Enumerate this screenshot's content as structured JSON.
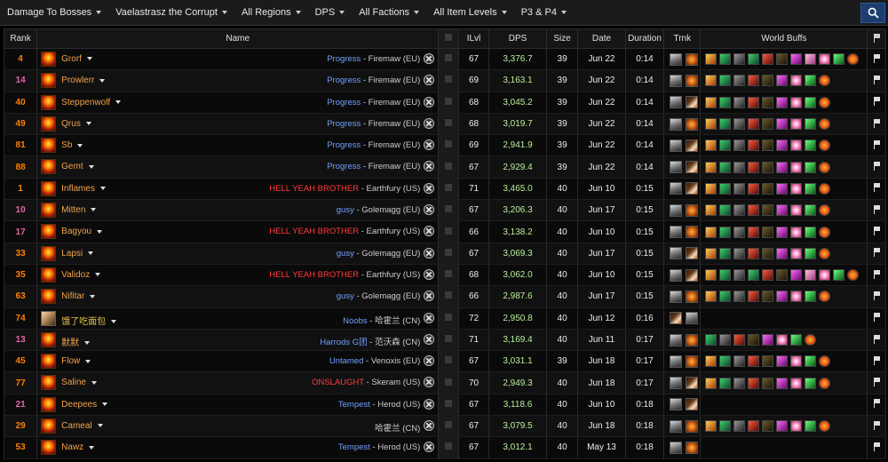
{
  "filters": [
    {
      "label": "Damage To Bosses"
    },
    {
      "label": "Vaelastrasz the Corrupt"
    },
    {
      "label": "All Regions"
    },
    {
      "label": "DPS"
    },
    {
      "label": "All Factions"
    },
    {
      "label": "All Item Levels"
    },
    {
      "label": "P3 & P4"
    }
  ],
  "columns": {
    "rank": "Rank",
    "name": "Name",
    "ilvl": "ILvl",
    "dps": "DPS",
    "size": "Size",
    "date": "Date",
    "duration": "Duration",
    "trnk": "Trnk",
    "buffs": "World Buffs"
  },
  "rows": [
    {
      "rank": "4",
      "rank_color": "orange",
      "name": "Grorf",
      "class": "mage",
      "guild": "Progress",
      "guild_color": "blue",
      "server": " - Firemaw (EU)",
      "ilvl": "67",
      "dps": "3,376.7",
      "size": "39",
      "date": "Jun 22",
      "duration": "0:14",
      "trnk": [
        "sapper",
        "bag"
      ],
      "buffs": [
        "b-ony",
        "b-zg",
        "b-dmf",
        "b-zg",
        "b-dm1",
        "b-dm2",
        "b-sp",
        "b-pink",
        "b-star",
        "b-green",
        "b-orange"
      ]
    },
    {
      "rank": "14",
      "rank_color": "pink",
      "name": "Prowlerr",
      "class": "mage",
      "guild": "Progress",
      "guild_color": "blue",
      "server": " - Firemaw (EU)",
      "ilvl": "69",
      "dps": "3,163.1",
      "size": "39",
      "date": "Jun 22",
      "duration": "0:14",
      "trnk": [
        "sapper",
        "bag"
      ],
      "buffs": [
        "b-ony",
        "b-zg",
        "b-dmf",
        "b-dm1",
        "b-dm2",
        "b-sp",
        "b-star",
        "b-green",
        "b-orange"
      ]
    },
    {
      "rank": "40",
      "rank_color": "orange",
      "name": "Steppenwolf",
      "class": "mage",
      "guild": "Progress",
      "guild_color": "blue",
      "server": " - Firemaw (EU)",
      "ilvl": "68",
      "dps": "3,045.2",
      "size": "39",
      "date": "Jun 22",
      "duration": "0:14",
      "trnk": [
        "sapper",
        "feather"
      ],
      "buffs": [
        "b-ony",
        "b-zg",
        "b-dmf",
        "b-dm1",
        "b-dm2",
        "b-sp",
        "b-star",
        "b-green",
        "b-orange"
      ]
    },
    {
      "rank": "49",
      "rank_color": "orange",
      "name": "Qrus",
      "class": "mage",
      "guild": "Progress",
      "guild_color": "blue",
      "server": " - Firemaw (EU)",
      "ilvl": "68",
      "dps": "3,019.7",
      "size": "39",
      "date": "Jun 22",
      "duration": "0:14",
      "trnk": [
        "sapper",
        "bag"
      ],
      "buffs": [
        "b-ony",
        "b-zg",
        "b-dmf",
        "b-dm1",
        "b-dm2",
        "b-sp",
        "b-star",
        "b-green",
        "b-orange"
      ]
    },
    {
      "rank": "81",
      "rank_color": "orange",
      "name": "Sb",
      "class": "mage",
      "guild": "Progress",
      "guild_color": "blue",
      "server": " - Firemaw (EU)",
      "ilvl": "69",
      "dps": "2,941.9",
      "size": "39",
      "date": "Jun 22",
      "duration": "0:14",
      "trnk": [
        "sapper",
        "feather"
      ],
      "buffs": [
        "b-ony",
        "b-zg",
        "b-dmf",
        "b-dm1",
        "b-dm2",
        "b-sp",
        "b-star",
        "b-green",
        "b-orange"
      ]
    },
    {
      "rank": "88",
      "rank_color": "orange",
      "name": "Gemt",
      "class": "mage",
      "guild": "Progress",
      "guild_color": "blue",
      "server": " - Firemaw (EU)",
      "ilvl": "67",
      "dps": "2,929.4",
      "size": "39",
      "date": "Jun 22",
      "duration": "0:14",
      "trnk": [
        "sapper",
        "feather"
      ],
      "buffs": [
        "b-ony",
        "b-zg",
        "b-dmf",
        "b-dm1",
        "b-dm2",
        "b-sp",
        "b-star",
        "b-green",
        "b-orange"
      ]
    },
    {
      "rank": "1",
      "rank_color": "orange",
      "name": "Inflames",
      "class": "mage",
      "guild": "HELL YEAH BROTHER",
      "guild_color": "red",
      "server": " - Earthfury (US)",
      "ilvl": "71",
      "dps": "3,465.0",
      "size": "40",
      "date": "Jun 10",
      "duration": "0:15",
      "trnk": [
        "sapper",
        "feather"
      ],
      "buffs": [
        "b-ony",
        "b-zg",
        "b-dmf",
        "b-dm1",
        "b-dm2",
        "b-sp",
        "b-star",
        "b-green",
        "b-orange"
      ]
    },
    {
      "rank": "10",
      "rank_color": "pink",
      "name": "Mitten",
      "class": "mage",
      "guild": "gusy",
      "guild_color": "blue",
      "server": " - Golemagg (EU)",
      "ilvl": "67",
      "dps": "3,206.3",
      "size": "40",
      "date": "Jun 17",
      "duration": "0:15",
      "trnk": [
        "sapper",
        "bag"
      ],
      "buffs": [
        "b-ony",
        "b-zg",
        "b-dmf",
        "b-dm1",
        "b-dm2",
        "b-sp",
        "b-star",
        "b-green",
        "b-orange"
      ]
    },
    {
      "rank": "17",
      "rank_color": "pink",
      "name": "Bagyou",
      "class": "mage",
      "guild": "HELL YEAH BROTHER",
      "guild_color": "red",
      "server": " - Earthfury (US)",
      "ilvl": "66",
      "dps": "3,138.2",
      "size": "40",
      "date": "Jun 10",
      "duration": "0:15",
      "trnk": [
        "sapper",
        "bag"
      ],
      "buffs": [
        "b-ony",
        "b-zg",
        "b-dmf",
        "b-dm1",
        "b-dm2",
        "b-sp",
        "b-star",
        "b-green",
        "b-orange"
      ]
    },
    {
      "rank": "33",
      "rank_color": "orange",
      "name": "Lapsi",
      "class": "mage",
      "guild": "gusy",
      "guild_color": "blue",
      "server": " - Golemagg (EU)",
      "ilvl": "67",
      "dps": "3,069.3",
      "size": "40",
      "date": "Jun 17",
      "duration": "0:15",
      "trnk": [
        "sapper",
        "feather"
      ],
      "buffs": [
        "b-ony",
        "b-zg",
        "b-dmf",
        "b-dm1",
        "b-dm2",
        "b-sp",
        "b-star",
        "b-green",
        "b-orange"
      ]
    },
    {
      "rank": "35",
      "rank_color": "orange",
      "name": "Validoz",
      "class": "mage",
      "guild": "HELL YEAH BROTHER",
      "guild_color": "red",
      "server": " - Earthfury (US)",
      "ilvl": "68",
      "dps": "3,062.0",
      "size": "40",
      "date": "Jun 10",
      "duration": "0:15",
      "trnk": [
        "sapper",
        "feather"
      ],
      "buffs": [
        "b-ony",
        "b-zg",
        "b-dmf",
        "b-zg",
        "b-dm1",
        "b-dm2",
        "b-sp",
        "b-pink",
        "b-star",
        "b-green",
        "b-orange"
      ]
    },
    {
      "rank": "63",
      "rank_color": "orange",
      "name": "Nifitar",
      "class": "mage",
      "guild": "gusy",
      "guild_color": "blue",
      "server": " - Golemagg (EU)",
      "ilvl": "66",
      "dps": "2,987.6",
      "size": "40",
      "date": "Jun 17",
      "duration": "0:15",
      "trnk": [
        "sapper",
        "bag"
      ],
      "buffs": [
        "b-ony",
        "b-zg",
        "b-dmf",
        "b-dm1",
        "b-dm2",
        "b-sp",
        "b-star",
        "b-green",
        "b-orange"
      ]
    },
    {
      "rank": "74",
      "rank_color": "orange",
      "name": "饿了吃面包",
      "class": "pala",
      "guild": "Noobs",
      "guild_color": "blue",
      "server": " - 哈霍兰 (CN)",
      "ilvl": "72",
      "dps": "2,950.8",
      "size": "40",
      "date": "Jun 12",
      "duration": "0:16",
      "trnk": [
        "feather",
        "sapper"
      ],
      "buffs": []
    },
    {
      "rank": "13",
      "rank_color": "pink",
      "name": "默默",
      "class": "mage",
      "guild": "Harrods G团",
      "guild_color": "blue",
      "server": " - 范沃森 (CN)",
      "ilvl": "71",
      "dps": "3,169.4",
      "size": "40",
      "date": "Jun 11",
      "duration": "0:17",
      "trnk": [
        "sapper",
        "bag"
      ],
      "buffs": [
        "b-zg",
        "b-dmf",
        "b-dm1",
        "b-dm2",
        "b-sp",
        "b-star",
        "b-green",
        "b-orange"
      ]
    },
    {
      "rank": "45",
      "rank_color": "orange",
      "name": "Flow",
      "class": "mage",
      "guild": "Untamed",
      "guild_color": "blue",
      "server": " - Venoxis (EU)",
      "ilvl": "67",
      "dps": "3,031.1",
      "size": "39",
      "date": "Jun 18",
      "duration": "0:17",
      "trnk": [
        "sapper",
        "bag"
      ],
      "buffs": [
        "b-ony",
        "b-zg",
        "b-dmf",
        "b-dm1",
        "b-dm2",
        "b-sp",
        "b-star",
        "b-green",
        "b-orange"
      ]
    },
    {
      "rank": "77",
      "rank_color": "orange",
      "name": "Saline",
      "class": "mage",
      "guild": "ONSLAUGHT",
      "guild_color": "red",
      "server": " - Skeram (US)",
      "ilvl": "70",
      "dps": "2,949.3",
      "size": "40",
      "date": "Jun 18",
      "duration": "0:17",
      "trnk": [
        "sapper",
        "feather"
      ],
      "buffs": [
        "b-ony",
        "b-zg",
        "b-dmf",
        "b-dm1",
        "b-dm2",
        "b-sp",
        "b-star",
        "b-green",
        "b-orange"
      ]
    },
    {
      "rank": "21",
      "rank_color": "pink",
      "name": "Deepees",
      "class": "mage",
      "guild": "Tempest",
      "guild_color": "blue",
      "server": " - Herod (US)",
      "ilvl": "67",
      "dps": "3,118.6",
      "size": "40",
      "date": "Jun 10",
      "duration": "0:18",
      "trnk": [
        "sapper",
        "feather"
      ],
      "buffs": []
    },
    {
      "rank": "29",
      "rank_color": "orange",
      "name": "Cameal",
      "class": "mage",
      "guild": "",
      "guild_color": "blue",
      "server": "哈霍兰 (CN)",
      "ilvl": "67",
      "dps": "3,079.5",
      "size": "40",
      "date": "Jun 18",
      "duration": "0:18",
      "trnk": [
        "sapper",
        "bag"
      ],
      "buffs": [
        "b-ony",
        "b-zg",
        "b-dmf",
        "b-dm1",
        "b-dm2",
        "b-sp",
        "b-star",
        "b-green",
        "b-orange"
      ]
    },
    {
      "rank": "53",
      "rank_color": "orange",
      "name": "Nawz",
      "class": "mage",
      "guild": "Tempest",
      "guild_color": "blue",
      "server": " - Herod (US)",
      "ilvl": "67",
      "dps": "3,012.1",
      "size": "40",
      "date": "May 13",
      "duration": "0:18",
      "trnk": [
        "sapper",
        "bag"
      ],
      "buffs": []
    }
  ]
}
